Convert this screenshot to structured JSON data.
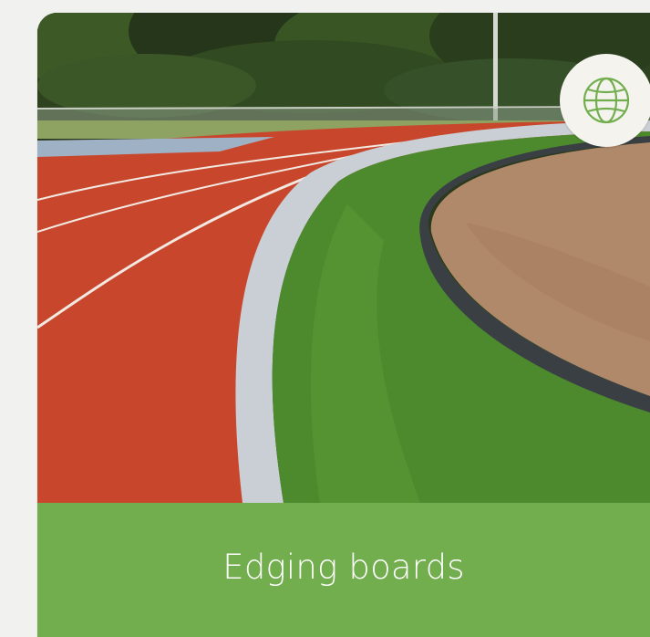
{
  "card": {
    "title": "Edging boards",
    "image_subject": "running-track-with-edging-boards",
    "badge_icon": "globe-icon"
  },
  "colors": {
    "caption_bg": "#72ae4e",
    "caption_text": "#ffffff",
    "badge_bg": "#f4f3ee",
    "badge_icon": "#72ae4e",
    "page_bg": "#f1f1ef"
  }
}
